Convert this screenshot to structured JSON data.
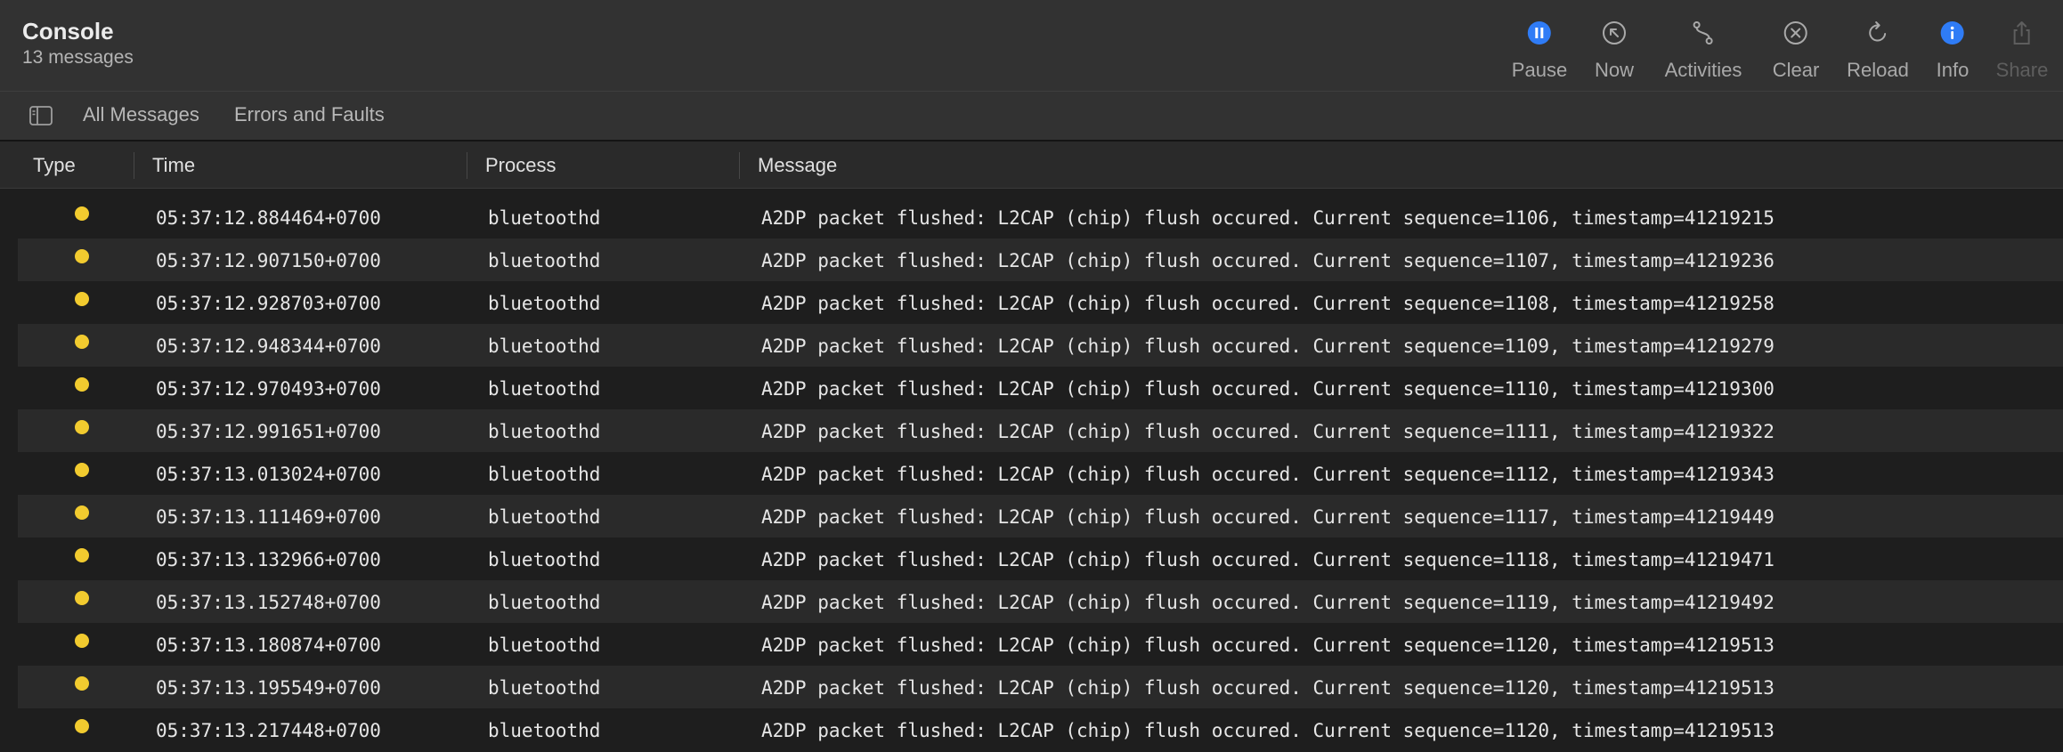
{
  "app": {
    "title": "Console",
    "subtitle": "13 messages"
  },
  "toolbar": {
    "pause": "Pause",
    "now": "Now",
    "activities": "Activities",
    "clear": "Clear",
    "reload": "Reload",
    "info": "Info",
    "share": "Share"
  },
  "filters": {
    "all": "All Messages",
    "errors": "Errors and Faults"
  },
  "columns": {
    "type": "Type",
    "time": "Time",
    "process": "Process",
    "message": "Message"
  },
  "colors": {
    "accent": "#2f7cf6",
    "default_dot": "#f2cb2f"
  },
  "rows": [
    {
      "time": "05:37:12.884464+0700",
      "process": "bluetoothd",
      "message": "A2DP packet flushed: L2CAP (chip) flush occured. Current sequence=1106, timestamp=41219215"
    },
    {
      "time": "05:37:12.907150+0700",
      "process": "bluetoothd",
      "message": "A2DP packet flushed: L2CAP (chip) flush occured. Current sequence=1107, timestamp=41219236"
    },
    {
      "time": "05:37:12.928703+0700",
      "process": "bluetoothd",
      "message": "A2DP packet flushed: L2CAP (chip) flush occured. Current sequence=1108, timestamp=41219258"
    },
    {
      "time": "05:37:12.948344+0700",
      "process": "bluetoothd",
      "message": "A2DP packet flushed: L2CAP (chip) flush occured. Current sequence=1109, timestamp=41219279"
    },
    {
      "time": "05:37:12.970493+0700",
      "process": "bluetoothd",
      "message": "A2DP packet flushed: L2CAP (chip) flush occured. Current sequence=1110, timestamp=41219300"
    },
    {
      "time": "05:37:12.991651+0700",
      "process": "bluetoothd",
      "message": "A2DP packet flushed: L2CAP (chip) flush occured. Current sequence=1111, timestamp=41219322"
    },
    {
      "time": "05:37:13.013024+0700",
      "process": "bluetoothd",
      "message": "A2DP packet flushed: L2CAP (chip) flush occured. Current sequence=1112, timestamp=41219343"
    },
    {
      "time": "05:37:13.111469+0700",
      "process": "bluetoothd",
      "message": "A2DP packet flushed: L2CAP (chip) flush occured. Current sequence=1117, timestamp=41219449"
    },
    {
      "time": "05:37:13.132966+0700",
      "process": "bluetoothd",
      "message": "A2DP packet flushed: L2CAP (chip) flush occured. Current sequence=1118, timestamp=41219471"
    },
    {
      "time": "05:37:13.152748+0700",
      "process": "bluetoothd",
      "message": "A2DP packet flushed: L2CAP (chip) flush occured. Current sequence=1119, timestamp=41219492"
    },
    {
      "time": "05:37:13.180874+0700",
      "process": "bluetoothd",
      "message": "A2DP packet flushed: L2CAP (chip) flush occured. Current sequence=1120, timestamp=41219513"
    },
    {
      "time": "05:37:13.195549+0700",
      "process": "bluetoothd",
      "message": "A2DP packet flushed: L2CAP (chip) flush occured. Current sequence=1120, timestamp=41219513"
    },
    {
      "time": "05:37:13.217448+0700",
      "process": "bluetoothd",
      "message": "A2DP packet flushed: L2CAP (chip) flush occured. Current sequence=1120, timestamp=41219513"
    }
  ]
}
